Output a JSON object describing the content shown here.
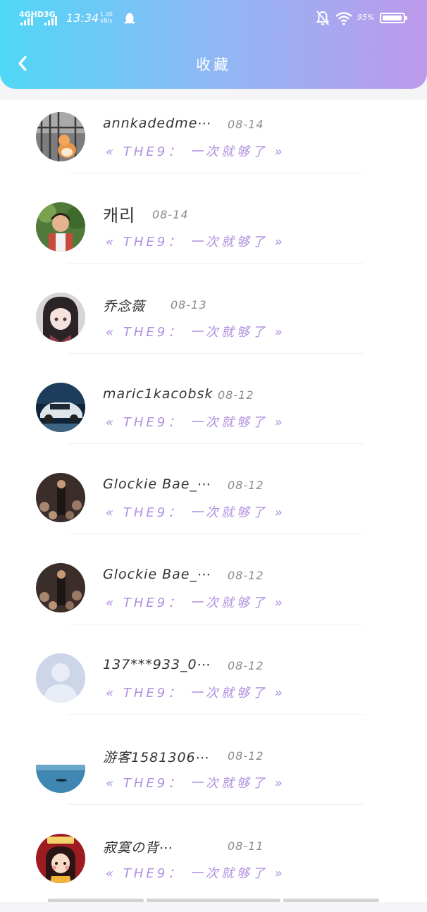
{
  "status_bar": {
    "network_1": "4GHD",
    "network_2": "3G",
    "time": "13:34",
    "speed_value": "1.20",
    "speed_unit": "kB/s",
    "battery": "95%",
    "battery_level": 0.95
  },
  "header": {
    "title": "收藏"
  },
  "favorites": [
    {
      "user": "annkadedme⋯",
      "date": "08-14",
      "item": "« THE9： 一次就够了 »"
    },
    {
      "user": "캐리",
      "date": "08-14",
      "item": "« THE9： 一次就够了 »"
    },
    {
      "user": "乔念薇",
      "date": "08-13",
      "item": "« THE9： 一次就够了 »"
    },
    {
      "user": "maric1kacobsk",
      "date": "08-12",
      "item": "« THE9： 一次就够了 »"
    },
    {
      "user": "Glockie Bae_⋯",
      "date": "08-12",
      "item": "« THE9： 一次就够了 »"
    },
    {
      "user": "Glockie Bae_⋯",
      "date": "08-12",
      "item": "« THE9： 一次就够了 »"
    },
    {
      "user": "137***933_0⋯",
      "date": "08-12",
      "item": "« THE9： 一次就够了 »"
    },
    {
      "user": "游客1581306⋯",
      "date": "08-12",
      "item": "« THE9： 一次就够了 »"
    },
    {
      "user": "寂寞の背⋯",
      "date": "08-11",
      "item": "« THE9： 一次就够了 »"
    }
  ]
}
